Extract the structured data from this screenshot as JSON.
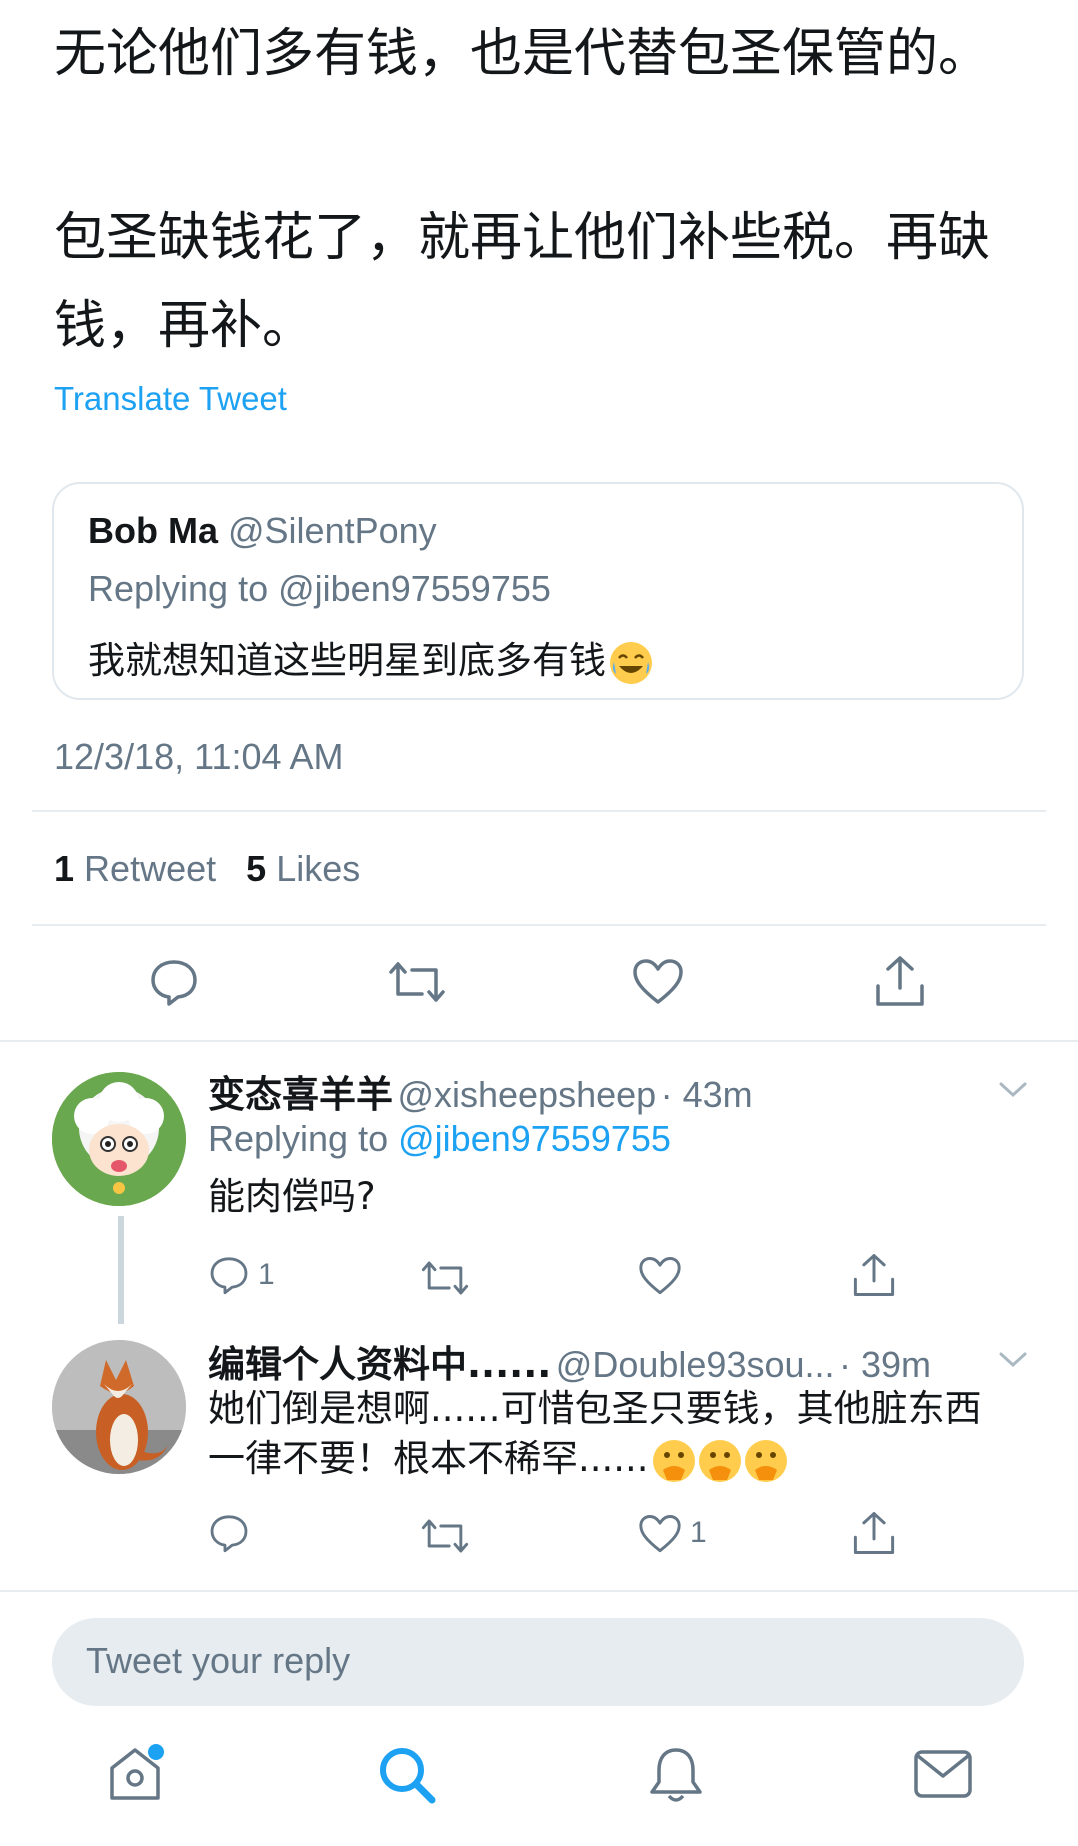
{
  "tweet": {
    "paragraph1": "无论他们多有钱，也是代替包圣保管的。",
    "paragraph2": "包圣缺钱花了，就再让他们补些税。再缺钱，再补。",
    "translate_label": "Translate Tweet",
    "quoted": {
      "name": "Bob Ma",
      "handle": "@SilentPony",
      "replying_to": "Replying to @jiben97559755",
      "text": "我就想知道这些明星到底多有钱",
      "emoji": "face-with-tears-of-joy"
    },
    "timestamp": "12/3/18, 11:04 AM",
    "retweet_count": "1",
    "retweet_label": "Retweet",
    "likes_count": "5",
    "likes_label": "Likes"
  },
  "replies": [
    {
      "name": "变态喜羊羊",
      "handle": "@xisheepsheep",
      "time": "· 43m",
      "replying_prefix": "Replying to",
      "replying_handle": "@jiben97559755",
      "text": "能肉偿吗?",
      "reply_count": "1",
      "like_count": ""
    },
    {
      "name": "编辑个人资料中......",
      "handle": "@Double93sou...",
      "time": "· 39m",
      "text_line1": "她们倒是想啊......可惜包圣只要钱，其他脏东西",
      "text_line2": "一律不要！根本不稀罕......",
      "emoji": "face-with-hand-over-mouth",
      "reply_count": "",
      "like_count": "1"
    }
  ],
  "reply_box": {
    "placeholder": "Tweet your reply"
  },
  "colors": {
    "accent": "#1da1f2",
    "muted": "#657786",
    "divider": "#e6ecf0"
  },
  "tabbar": [
    "home-icon",
    "search-icon",
    "notifications-icon",
    "messages-icon"
  ]
}
